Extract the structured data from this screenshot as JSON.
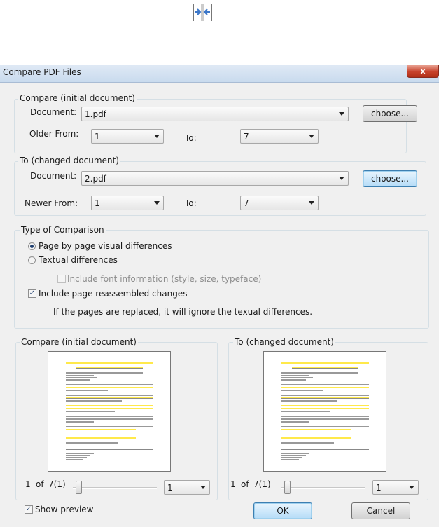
{
  "dialog": {
    "title": "Compare PDF Files",
    "close_symbol": "x"
  },
  "initial": {
    "legend": "Compare (initial document)",
    "document_label": "Document:",
    "document_value": "1.pdf",
    "choose_label": "choose...",
    "from_label": "Older From:",
    "from_value": "1",
    "to_label": "To:",
    "to_value": "7"
  },
  "changed": {
    "legend": "To (changed document)",
    "document_label": "Document:",
    "document_value": "2.pdf",
    "choose_label": "choose...",
    "from_label": "Newer From:",
    "from_value": "1",
    "to_label": "To:",
    "to_value": "7"
  },
  "comparison": {
    "legend": "Type of Comparison",
    "visual_label": "Page by page visual differences",
    "visual_selected": true,
    "textual_label": "Textual differences",
    "textual_selected": false,
    "font_info_label": "Include font information (style, size, typeface)",
    "reassembled_label": "Include page reassembled changes",
    "reassembled_checked": true,
    "note": "If the pages are replaced, it will ignore the texual differences."
  },
  "preview_initial": {
    "legend": "Compare (initial document)",
    "page_num": "1",
    "of_label": "of",
    "page_total": "7(1)",
    "page_select": "1"
  },
  "preview_changed": {
    "legend": "To (changed document)",
    "page_num": "1",
    "of_label": "of",
    "page_total": "7(1)",
    "page_select": "1"
  },
  "footer": {
    "show_preview_label": "Show preview",
    "show_preview_checked": true,
    "ok_label": "OK",
    "cancel_label": "Cancel"
  },
  "icons": {
    "compare_toolbar": "compare-arrows-icon"
  },
  "colors": {
    "highlight": "#ffe94a",
    "focus_border": "#3c7fb1",
    "close_red": "#c7422c"
  }
}
